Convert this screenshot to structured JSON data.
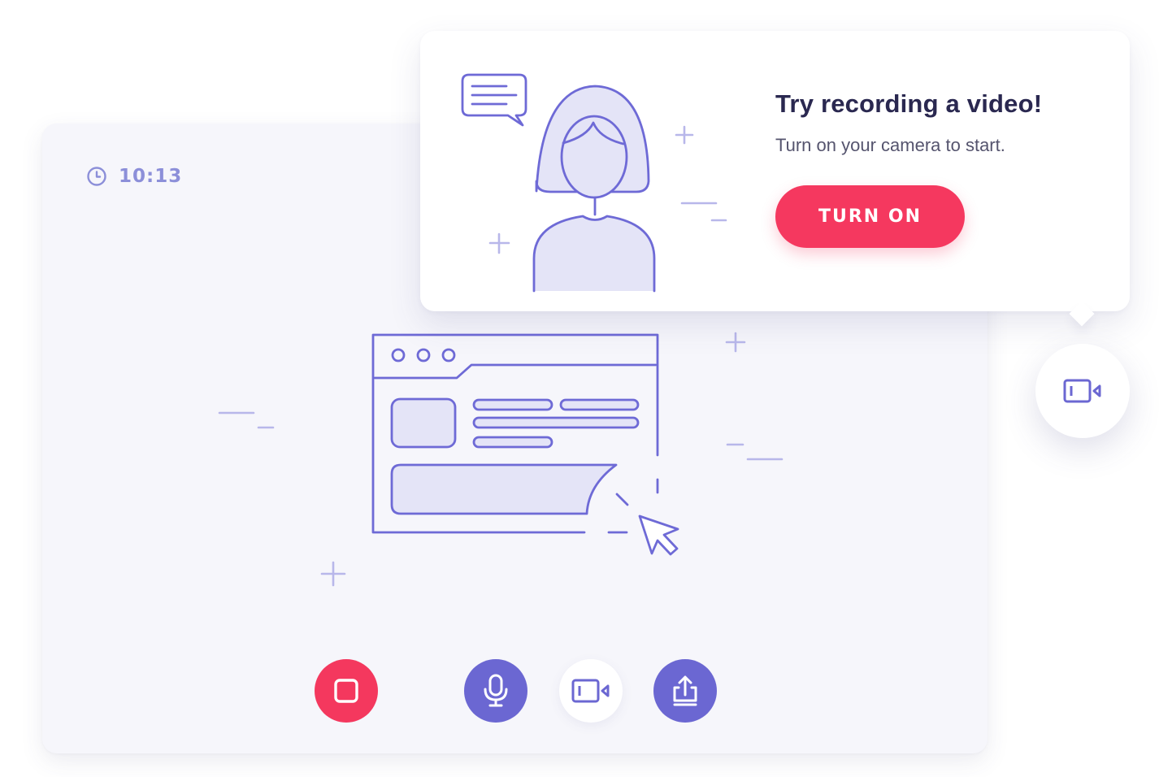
{
  "recorder": {
    "timer": "10:13",
    "controls": {
      "stop_color": "#f4385e",
      "mic_color": "#6b67d2",
      "camera_color": "#ffffff",
      "share_color": "#6b67d2"
    }
  },
  "popup": {
    "title": "Try recording a video!",
    "subtitle": "Turn on your camera to start.",
    "button_label": "TURN ON",
    "button_color": "#f5385f"
  },
  "icons": {
    "timer": "clock-icon",
    "stop": "stop-icon",
    "mic": "microphone-icon",
    "camera": "video-camera-icon",
    "share": "share-upload-icon",
    "floating_camera": "video-camera-icon"
  },
  "colors": {
    "accent": "#6b67d2",
    "illustration_stroke": "#6e6ad6",
    "illustration_fill": "#e4e4f7",
    "background": "#f6f6fb"
  }
}
